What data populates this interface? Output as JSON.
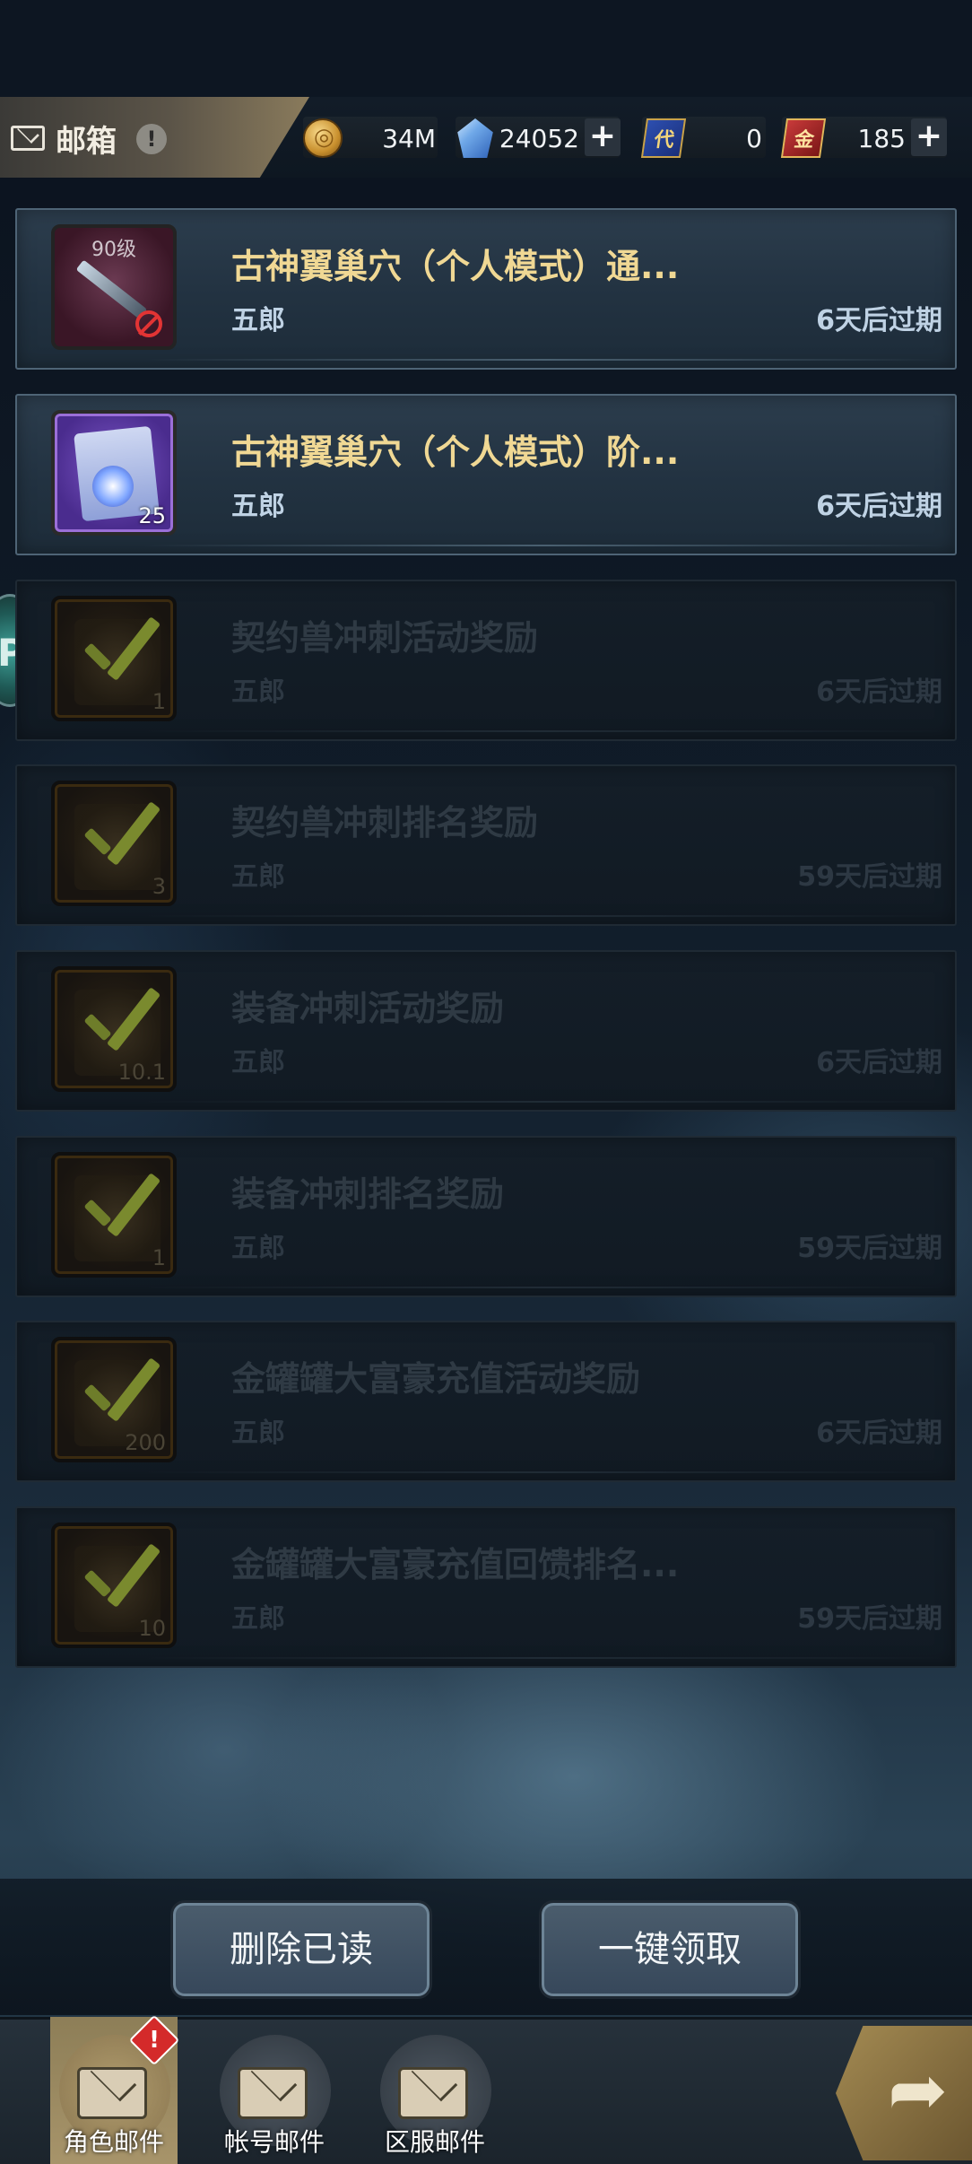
{
  "header": {
    "title": "邮箱",
    "info_badge": "!",
    "resources": [
      {
        "icon": "gold-coin-icon",
        "value": "34M"
      },
      {
        "icon": "crystal-icon",
        "value": "24052"
      },
      {
        "icon": "blue-card-icon",
        "value": "0"
      },
      {
        "icon": "red-card-icon",
        "value": "185"
      }
    ],
    "plus": "+"
  },
  "mails": [
    {
      "title": "古神翼巢穴（个人模式）通...",
      "sender": "五郎",
      "expire": "6天后过期",
      "read": false,
      "thumb_top": "90级",
      "count": ""
    },
    {
      "title": "古神翼巢穴（个人模式）阶...",
      "sender": "五郎",
      "expire": "6天后过期",
      "read": false,
      "thumb_top": "",
      "count": "25"
    },
    {
      "title": "契约兽冲刺活动奖励",
      "sender": "五郎",
      "expire": "6天后过期",
      "read": true,
      "count": "1"
    },
    {
      "title": "契约兽冲刺排名奖励",
      "sender": "五郎",
      "expire": "59天后过期",
      "read": true,
      "count": "3"
    },
    {
      "title": "装备冲刺活动奖励",
      "sender": "五郎",
      "expire": "6天后过期",
      "read": true,
      "count": "10.1"
    },
    {
      "title": "装备冲刺排名奖励",
      "sender": "五郎",
      "expire": "59天后过期",
      "read": true,
      "count": "1"
    },
    {
      "title": "金罐罐大富豪充值活动奖励",
      "sender": "五郎",
      "expire": "6天后过期",
      "read": true,
      "count": "200"
    },
    {
      "title": "金罐罐大富豪充值回馈排名...",
      "sender": "五郎",
      "expire": "59天后过期",
      "read": true,
      "count": "10"
    }
  ],
  "actions": {
    "delete_read": "删除已读",
    "claim_all": "一键领取"
  },
  "tabs": [
    {
      "label": "角色邮件",
      "active": true,
      "alert": "!"
    },
    {
      "label": "帐号邮件",
      "active": false
    },
    {
      "label": "区服邮件",
      "active": false
    }
  ]
}
